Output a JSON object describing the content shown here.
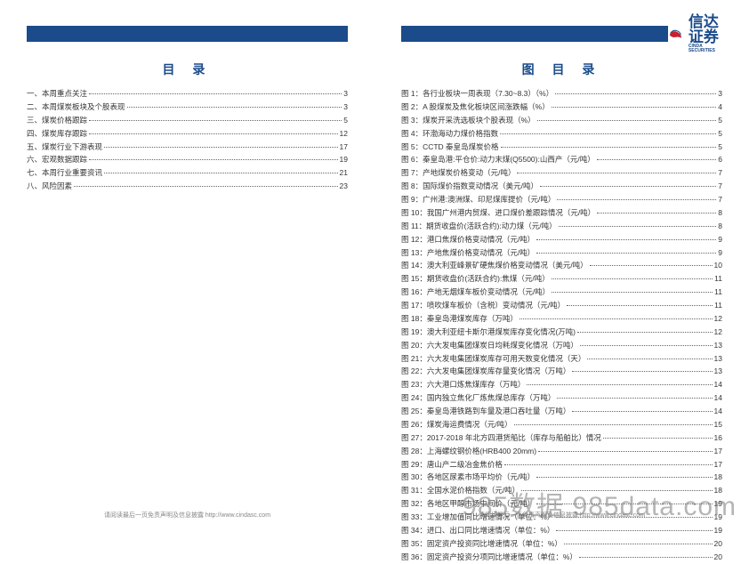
{
  "brand": {
    "name": "信达证券",
    "sub": "CINDA SECURITIES"
  },
  "left": {
    "title": "目 录",
    "items": [
      {
        "label": "一、本周重点关注",
        "page": "3"
      },
      {
        "label": "二、本周煤炭板块及个股表现",
        "page": "3"
      },
      {
        "label": "三、煤炭价格跟踪",
        "page": "5"
      },
      {
        "label": "四、煤炭库存跟踪",
        "page": "12"
      },
      {
        "label": "五、煤炭行业下游表现",
        "page": "17"
      },
      {
        "label": "六、宏观数据跟踪",
        "page": "19"
      },
      {
        "label": "七、本周行业重要资讯",
        "page": "21"
      },
      {
        "label": "八、风险因素",
        "page": "23"
      }
    ]
  },
  "right": {
    "title": "图 目 录",
    "items": [
      {
        "label": "图 1：各行业板块一周表现（7.30~8.3）（%）",
        "page": "3"
      },
      {
        "label": "图 2：A 股煤炭及焦化板块区间涨跌幅（%）",
        "page": "4"
      },
      {
        "label": "图 3：煤炭开采洗选板块个股表现（%）",
        "page": "5"
      },
      {
        "label": "图 4：环渤海动力煤价格指数",
        "page": "5"
      },
      {
        "label": "图 5：CCTD 秦皇岛煤炭价格",
        "page": "5"
      },
      {
        "label": "图 6：秦皇岛港:平仓价:动力末煤(Q5500):山西产（元/吨）",
        "page": "6"
      },
      {
        "label": "图 7：产地煤炭价格变动（元/吨）",
        "page": "7"
      },
      {
        "label": "图 8：国际煤价指数变动情况（美元/吨）",
        "page": "7"
      },
      {
        "label": "图 9：广州港:澳洲煤、印尼煤库提价（元/吨）",
        "page": "7"
      },
      {
        "label": "图 10：我国广州港内贸煤、进口煤价差跟踪情况（元/吨）",
        "page": "8"
      },
      {
        "label": "图 11：期货收盘价(活跃合约):动力煤（元/吨）",
        "page": "8"
      },
      {
        "label": "图 12：港口焦煤价格变动情况（元/吨）",
        "page": "9"
      },
      {
        "label": "图 13：产地焦煤价格变动情况（元/吨）",
        "page": "9"
      },
      {
        "label": "图 14：澳大利亚峰景矿硬焦煤价格变动情况（美元/吨）",
        "page": "10"
      },
      {
        "label": "图 15：期货收盘价(活跃合约):焦煤（元/吨）",
        "page": "11"
      },
      {
        "label": "图 16：产地无烟煤车板价变动情况（元/吨）",
        "page": "11"
      },
      {
        "label": "图 17：喷吹煤车板价（含税）变动情况（元/吨）",
        "page": "11"
      },
      {
        "label": "图 18：秦皇岛港煤炭库存（万吨）",
        "page": "12"
      },
      {
        "label": "图 19：澳大利亚纽卡斯尔港煤炭库存变化情况(万吨)",
        "page": "12"
      },
      {
        "label": "图 20：六大发电集团煤炭日均耗煤变化情况（万吨）",
        "page": "13"
      },
      {
        "label": "图 21：六大发电集团煤炭库存可用天数变化情况（天）",
        "page": "13"
      },
      {
        "label": "图 22：六大发电集团煤炭库存量变化情况（万吨）",
        "page": "13"
      },
      {
        "label": "图 23：六大港口炼焦煤库存（万吨）",
        "page": "14"
      },
      {
        "label": "图 24：国内独立焦化厂炼焦煤总库存（万吨）",
        "page": "14"
      },
      {
        "label": "图 25：秦皇岛港铁路到车量及港口吞吐量（万吨）",
        "page": "14"
      },
      {
        "label": "图 26：煤炭海运费情况（元/吨）",
        "page": "15"
      },
      {
        "label": "图 27：2017-2018 年北方四港货船比（库存与船舶比）情况",
        "page": "16"
      },
      {
        "label": "图 28：上海螺纹钢价格(HRB400 20mm)",
        "page": "17"
      },
      {
        "label": "图 29：唐山产二级冶金焦价格",
        "page": "17"
      },
      {
        "label": "图 30：各地区尿素市场平均价（元/吨）",
        "page": "18"
      },
      {
        "label": "图 31：全国水泥价格指数（元/吨）",
        "page": "18"
      },
      {
        "label": "图 32：各地区甲醇市场中间价（元/吨）",
        "page": "19"
      },
      {
        "label": "图 33：工业增加值同比增速情况（单位：%）",
        "page": "19"
      },
      {
        "label": "图 34：进口、出口同比增速情况（单位：%）",
        "page": "19"
      },
      {
        "label": "图 35：固定资产投资同比增速情况（单位：%）",
        "page": "20"
      },
      {
        "label": "图 36：固定资产投资分项同比增速情况（单位：%）",
        "page": "20"
      }
    ]
  },
  "footer": "请阅读最后一页免责声明及信息披露 http://www.cindasc.com",
  "watermark": "985数据 985data.com"
}
